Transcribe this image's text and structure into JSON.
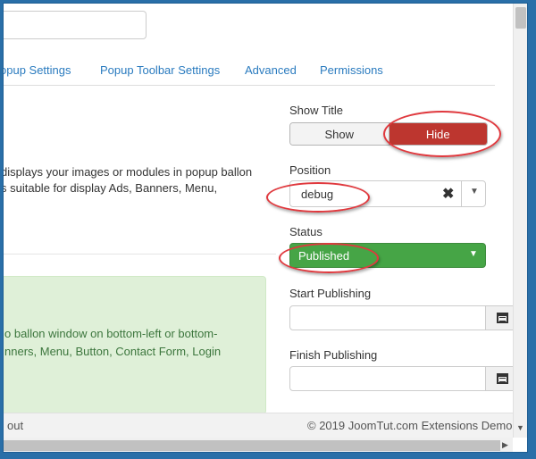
{
  "tabs": [
    {
      "label": "opup Settings"
    },
    {
      "label": "Popup Toolbar Settings"
    },
    {
      "label": "Advanced"
    },
    {
      "label": "Permissions"
    }
  ],
  "description": {
    "line1": "displays your images or modules in popup ballon",
    "line2": "s suitable for display Ads, Banners, Menu,"
  },
  "alert": {
    "line1": "o ballon window on bottom-left or bottom-",
    "line2": "nners, Menu, Button, Contact Form, Login"
  },
  "fields": {
    "show_title": {
      "label": "Show Title",
      "options": [
        "Show",
        "Hide"
      ],
      "selected": "Hide"
    },
    "position": {
      "label": "Position",
      "value": "debug",
      "clear_glyph": "✖",
      "caret_glyph": "▼"
    },
    "status": {
      "label": "Status",
      "value": "Published",
      "caret_glyph": "▼"
    },
    "start_publishing": {
      "label": "Start Publishing",
      "value": ""
    },
    "finish_publishing": {
      "label": "Finish Publishing",
      "value": ""
    }
  },
  "footer": {
    "left": "out",
    "right": "© 2019 JoomTut.com Extensions Demo"
  },
  "colors": {
    "hide_active": "#bd362f",
    "status_green": "#46a546",
    "annotation": "#e0393e",
    "link": "#2a7bbf"
  },
  "icons": {
    "calendar": "calendar-icon",
    "clear": "clear-icon",
    "caret": "chevron-down-icon"
  }
}
